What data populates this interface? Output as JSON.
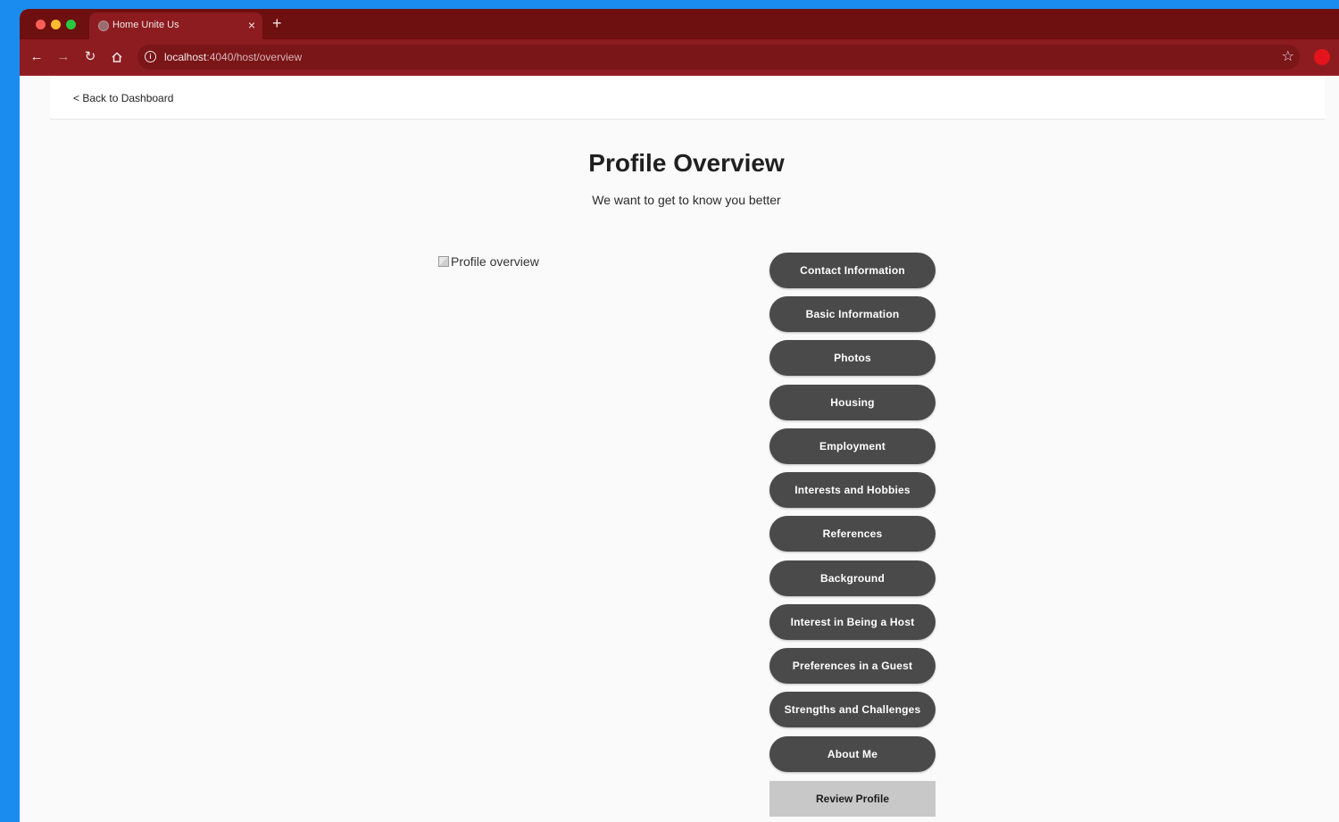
{
  "browser": {
    "tab_title": "Home Unite Us",
    "tab_close": "×",
    "new_tab": "+",
    "url_host": "localhost",
    "url_path": ":4040/host/overview"
  },
  "page": {
    "back_link": "< Back to Dashboard",
    "title": "Profile Overview",
    "subtitle": "We want to get to know you better",
    "image_alt": "Profile overview",
    "sections": [
      "Contact Information",
      "Basic Information",
      "Photos",
      "Housing",
      "Employment",
      "Interests and Hobbies",
      "References",
      "Background",
      "Interest in Being a Host",
      "Preferences in a Guest",
      "Strengths and Challenges",
      "About Me"
    ],
    "review_button": "Review Profile"
  },
  "colors": {
    "browser_frame": "#8c1c20",
    "button_dark": "#4a4a4a",
    "button_review": "#c8c8c8"
  }
}
